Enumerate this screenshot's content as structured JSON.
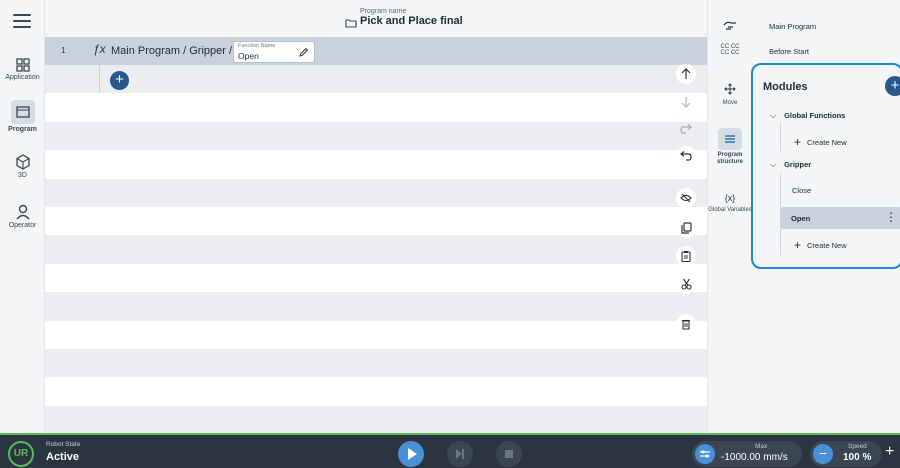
{
  "nav": {
    "items": [
      {
        "label": "Application",
        "icon": "grid-icon"
      },
      {
        "label": "Program",
        "icon": "program-icon"
      },
      {
        "label": "3D",
        "icon": "cube-icon"
      },
      {
        "label": "Operator",
        "icon": "person-icon"
      }
    ]
  },
  "header": {
    "program_name_label": "Program name",
    "program_name": "Pick and Place final"
  },
  "program": {
    "row_number": "1",
    "path": "Main Program / Gripper /",
    "function_name_label": "Function Name",
    "function_name_value": "Open",
    "row_count": 14
  },
  "rightnav": {
    "cc_text": "CC CC CC CC",
    "move_label": "Move",
    "structure_label": "Program structure",
    "variables_label": "Global Variables"
  },
  "panel": {
    "main_program": "Main Program",
    "before_start": "Before Start",
    "modules_title": "Modules",
    "global_functions": "Global Functions",
    "create_new_1": "Create New",
    "gripper": "Gripper",
    "close": "Close",
    "open": "Open",
    "create_new_2": "Create New"
  },
  "bottom": {
    "robot_state_label": "Robot State",
    "robot_state": "Active",
    "max_label": "Max",
    "max_value": "-1000.00 mm/s",
    "speed_label": "Speed",
    "speed_value": "100 %"
  },
  "colors": {
    "accent": "#27578b",
    "highlight_border": "#1a8ad4",
    "status_green": "#5cb85c"
  }
}
